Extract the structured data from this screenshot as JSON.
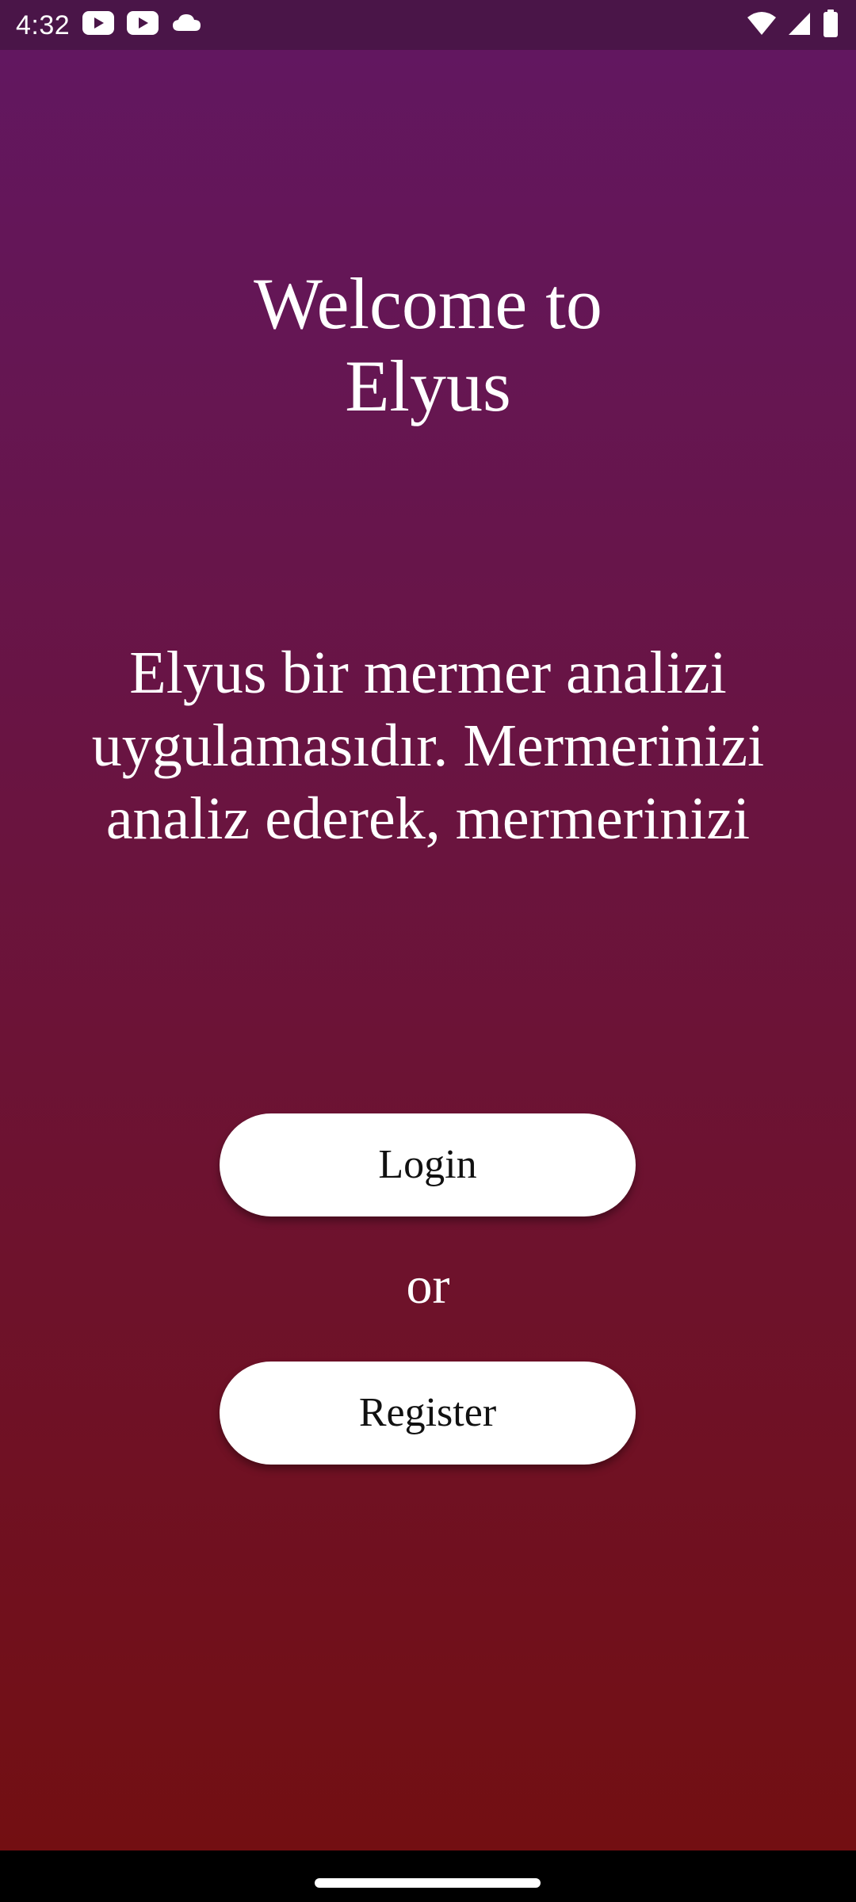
{
  "status_bar": {
    "time": "4:32",
    "left_icons": [
      "youtube-icon",
      "youtube-icon",
      "cloud-icon"
    ],
    "right_icons": [
      "wifi-icon",
      "cellular-signal-icon",
      "battery-icon"
    ]
  },
  "welcome": {
    "title_line1": "Welcome to",
    "title_line2": "Elyus"
  },
  "description": {
    "line1": "Elyus bir mermer analizi",
    "line2": "uygulamasıdır. Mermerinizi",
    "line3": "analiz ederek, mermerinizi"
  },
  "actions": {
    "login_label": "Login",
    "or_label": "or",
    "register_label": "Register"
  },
  "colors": {
    "status_bar": "#4a1548",
    "gradient_top": "#621760",
    "gradient_bottom": "#730f12",
    "button_bg": "#ffffff",
    "button_text": "#111111"
  }
}
